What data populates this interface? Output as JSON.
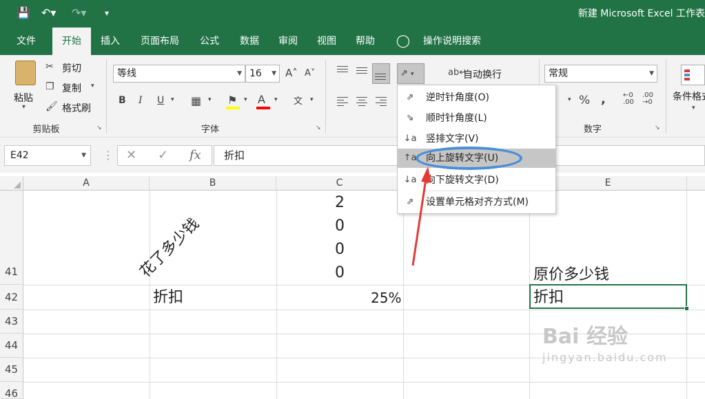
{
  "app": {
    "title": "新建 Microsoft Excel 工作表"
  },
  "tabs": [
    {
      "label": "文件"
    },
    {
      "label": "开始"
    },
    {
      "label": "插入"
    },
    {
      "label": "页面布局"
    },
    {
      "label": "公式"
    },
    {
      "label": "数据"
    },
    {
      "label": "审阅"
    },
    {
      "label": "视图"
    },
    {
      "label": "帮助"
    },
    {
      "label": "操作说明搜索"
    }
  ],
  "ribbon": {
    "clipboard": {
      "paste": "粘贴",
      "cut": "剪切",
      "copy": "复制",
      "format_painter": "格式刷",
      "group": "剪贴板"
    },
    "font": {
      "name": "等线",
      "size": "16",
      "group": "字体"
    },
    "alignment": {
      "wrap_text": "自动换行"
    },
    "number": {
      "format": "常规",
      "group": "数字"
    },
    "styles": {
      "conditional": "条件格式"
    }
  },
  "formula_bar": {
    "name_box": "E42",
    "value": "折扣"
  },
  "columns": [
    "A",
    "B",
    "C",
    "E"
  ],
  "rows": [
    "41",
    "42",
    "43",
    "44",
    "45",
    "46"
  ],
  "cells": {
    "b41": "花了多少钱",
    "c41": [
      "2",
      "0",
      "0",
      "0"
    ],
    "e41": "原价多少钱",
    "b42": "折扣",
    "c42": "25%",
    "e42": "折扣"
  },
  "orientation_menu": [
    {
      "label": "逆时针角度(O)",
      "icon": "rotate-ccw-icon"
    },
    {
      "label": "顺时针角度(L)",
      "icon": "rotate-cw-icon"
    },
    {
      "label": "竖排文字(V)",
      "icon": "vertical-text-icon"
    },
    {
      "label": "向上旋转文字(U)",
      "icon": "rotate-up-icon",
      "highlighted": true
    },
    {
      "label": "向下旋转文字(D)",
      "icon": "rotate-down-icon"
    },
    {
      "label": "设置单元格对齐方式(M)",
      "icon": "format-alignment-icon"
    }
  ],
  "watermark": {
    "main": "Bai 经验",
    "sub": "jingyan.baidu.com"
  },
  "colors": {
    "accent": "#217346",
    "annotation": "#4a8fd7",
    "arrow": "#e53935"
  }
}
